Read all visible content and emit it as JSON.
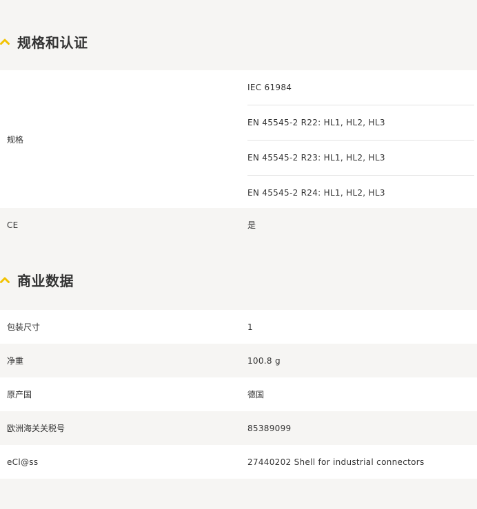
{
  "sections": [
    {
      "title": "规格和认证",
      "rows": [
        {
          "label": "规格",
          "values": [
            "IEC 61984",
            "EN 45545-2 R22: HL1, HL2, HL3",
            "EN 45545-2 R23: HL1, HL2, HL3",
            "EN 45545-2 R24: HL1, HL2, HL3"
          ]
        },
        {
          "label": "CE",
          "value": "是"
        }
      ]
    },
    {
      "title": "商业数据",
      "rows": [
        {
          "label": "包装尺寸",
          "value": "1"
        },
        {
          "label": "净重",
          "value": "100.8 g"
        },
        {
          "label": "原产国",
          "value": "德国"
        },
        {
          "label": "欧洲海关关税号",
          "value": "85389099"
        },
        {
          "label": "eCl@ss",
          "value": "27440202 Shell for industrial connectors"
        }
      ]
    }
  ],
  "colors": {
    "accent": "#f2c200",
    "row_white": "#ffffff",
    "row_grey": "#f6f5f3"
  },
  "icons": {
    "section_toggle": "chevron-up-icon"
  }
}
